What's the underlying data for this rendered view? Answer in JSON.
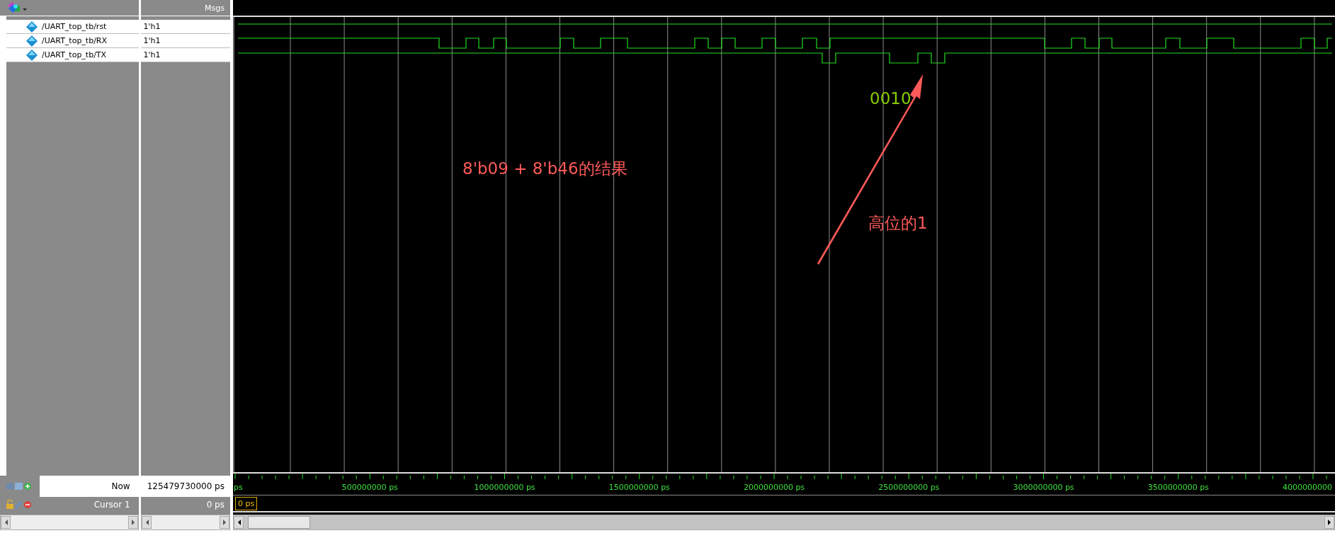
{
  "header": {
    "column_2": "Msgs"
  },
  "signals": [
    {
      "name": "/UART_top_tb/rst",
      "value": "1'h1"
    },
    {
      "name": "/UART_top_tb/RX",
      "value": "1'h1"
    },
    {
      "name": "/UART_top_tb/TX",
      "value": "1'h1"
    }
  ],
  "now": {
    "label": "Now",
    "value": "125479730000 ps"
  },
  "cursor": {
    "label": "Cursor 1",
    "value": "0 ps",
    "marker": "0 ps"
  },
  "time_axis": {
    "labels": [
      "ps",
      "500000000 ps",
      "1000000000 ps",
      "1500000000 ps",
      "2000000000 ps",
      "2500000000 ps",
      "3000000000 ps",
      "3500000000 ps",
      "4000000000"
    ]
  },
  "annotations": [
    {
      "kind": "label",
      "text": "8'b09 + 8'b46的结果",
      "color": "#ff5a5a"
    },
    {
      "kind": "label",
      "text": "0010",
      "color": "#88cc00"
    },
    {
      "kind": "label",
      "text": "高位的1",
      "color": "#ff5a5a"
    },
    {
      "kind": "arrow",
      "color": "#ff5a5a"
    }
  ]
}
